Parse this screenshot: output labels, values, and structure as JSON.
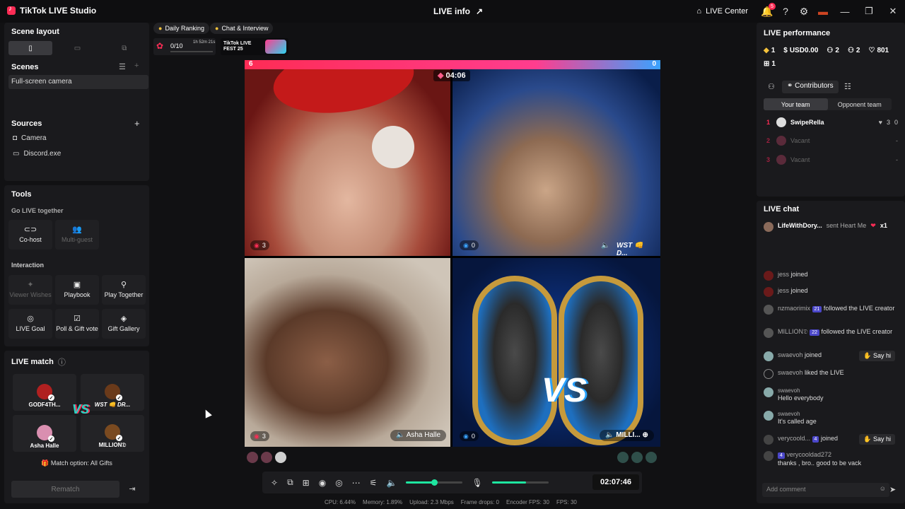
{
  "titlebar": {
    "app_title": "TikTok LIVE Studio",
    "center_title": "LIVE info",
    "live_center": "LIVE Center",
    "notifications_count": "5"
  },
  "left": {
    "scene_layout": "Scene layout",
    "scenes": "Scenes",
    "scene_item": "Full-screen camera",
    "sources": "Sources",
    "sources_items": [
      "Camera",
      "Discord.exe"
    ],
    "tools": "Tools",
    "go_live_together": "Go LIVE together",
    "cohost": "Co-host",
    "multiguest": "Multi-guest",
    "interaction": "Interaction",
    "viewer_wishes": "Viewer Wishes",
    "playbook": "Playbook",
    "play_together": "Play Together",
    "live_goal": "LIVE Goal",
    "poll_gift_vote": "Poll & Gift vote",
    "gift_gallery": "Gift Gallery",
    "live_match": "LIVE match",
    "players": [
      "GODF4TH...",
      "WST 👊 DR...",
      "Asha Halle",
      "MILLION𝔇"
    ],
    "vs": "VS",
    "match_option": "Match option: All Gifts",
    "rematch": "Rematch"
  },
  "top": {
    "daily_ranking": "Daily Ranking",
    "chat_interview": "Chat & Interview",
    "goal_count": "0/10",
    "goal_time": "1h 52m 21s",
    "fest_text": "TikTok LIVE FEST 25"
  },
  "stage": {
    "left_score": "6",
    "right_score": "0",
    "timer": "04:06",
    "tiles": [
      {
        "score": "3"
      },
      {
        "score": "0",
        "name": "WST 👊 D..."
      },
      {
        "score": "3",
        "name": "Asha Halle"
      },
      {
        "score": "0",
        "name": "MILLI..."
      }
    ],
    "vs_text": "VS"
  },
  "controls": {
    "clock": "02:07:46",
    "mic_level": 0.6,
    "speaker_level": 0.5
  },
  "stats": {
    "cpu": "CPU: 6.44%",
    "memory": "Memory: 1.89%",
    "upload": "Upload: 2.3 Mbps",
    "frame_drops": "Frame drops: 0",
    "encoder_fps": "Encoder FPS: 30",
    "fps": "FPS: 30"
  },
  "perf": {
    "title": "LIVE performance",
    "diamonds": "1",
    "usd": "USD0.00",
    "viewers": "2",
    "new_followers": "2",
    "likes": "801",
    "gifters": "1",
    "contributors": "Contributors",
    "your_team": "Your team",
    "opponent_team": "Opponent team",
    "ranks": [
      {
        "n": "1",
        "name": "SwipeRella",
        "a": "3",
        "b": "0"
      },
      {
        "n": "2",
        "name": "Vacant",
        "a": "-"
      },
      {
        "n": "3",
        "name": "Vacant",
        "a": "-"
      }
    ]
  },
  "chat": {
    "title": "LIVE chat",
    "pinned_user": "LifeWithDory...",
    "pinned_text": "sent Heart Me",
    "pinned_count": "x1",
    "messages": [
      {
        "u": "jess",
        "t": "joined"
      },
      {
        "u": "jess",
        "t": "joined"
      },
      {
        "u": "nzmaorimix",
        "lvl": "21",
        "t": "followed the LIVE creator"
      },
      {
        "u": "MILLION𝔇",
        "lvl": "22",
        "t": "followed the LIVE creator"
      },
      {
        "u": "swaevoh",
        "t": "joined",
        "btn": "Say hi"
      },
      {
        "u": "swaevoh",
        "t": "liked the LIVE"
      },
      {
        "u": "swaevoh",
        "t": "Hello everybody"
      },
      {
        "u": "swaevoh",
        "t": "It's called age"
      },
      {
        "u": "verycoold...",
        "lvl": "4",
        "t": "joined",
        "btn": "Say hi"
      },
      {
        "u": "verycooldad272",
        "lvl": "4",
        "t": "thanks , bro.. good to be vack"
      }
    ],
    "add_comment": "Add comment"
  },
  "colors": {
    "accent": "#fe2c55",
    "teal": "#1ee6a0",
    "bg": "#111113"
  }
}
